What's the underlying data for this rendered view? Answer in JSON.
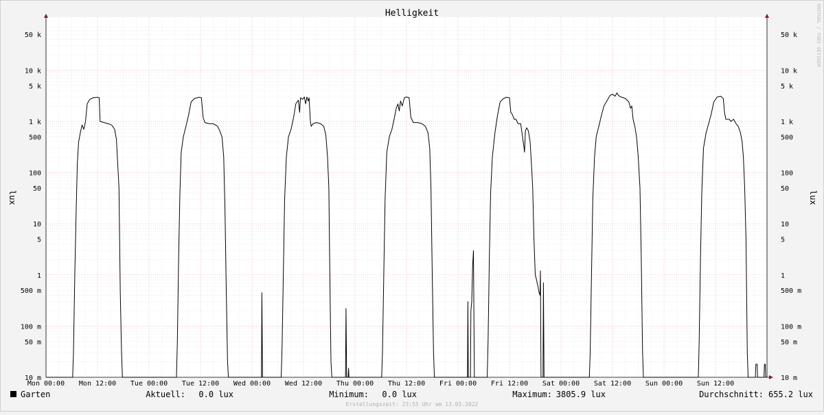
{
  "chart_data": {
    "type": "line",
    "title": "Helligkeit",
    "ylabel_left": "lux",
    "ylabel_right": "lux",
    "watermark": "RRDTOOL / TOBI OETIKER",
    "scale": "log",
    "ylim": [
      0.01,
      80000
    ],
    "xlim": [
      0,
      168
    ],
    "grid": true,
    "y_ticks": [
      {
        "v": 0.01,
        "label": "10 m"
      },
      {
        "v": 0.05,
        "label": "50 m"
      },
      {
        "v": 0.1,
        "label": "100 m"
      },
      {
        "v": 0.5,
        "label": "500 m"
      },
      {
        "v": 1,
        "label": "1"
      },
      {
        "v": 5,
        "label": "5"
      },
      {
        "v": 10,
        "label": "10"
      },
      {
        "v": 50,
        "label": "50"
      },
      {
        "v": 100,
        "label": "100"
      },
      {
        "v": 500,
        "label": "500"
      },
      {
        "v": 1000,
        "label": "1 k"
      },
      {
        "v": 5000,
        "label": "5 k"
      },
      {
        "v": 10000,
        "label": "10 k"
      },
      {
        "v": 50000,
        "label": "50 k"
      }
    ],
    "x_ticks": [
      {
        "h": 0,
        "label": "Mon 00:00"
      },
      {
        "h": 12,
        "label": "Mon 12:00"
      },
      {
        "h": 24,
        "label": "Tue 00:00"
      },
      {
        "h": 36,
        "label": "Tue 12:00"
      },
      {
        "h": 48,
        "label": "Wed 00:00"
      },
      {
        "h": 60,
        "label": "Wed 12:00"
      },
      {
        "h": 72,
        "label": "Thu 00:00"
      },
      {
        "h": 84,
        "label": "Thu 12:00"
      },
      {
        "h": 96,
        "label": "Fri 00:00"
      },
      {
        "h": 108,
        "label": "Fri 12:00"
      },
      {
        "h": 120,
        "label": "Sat 00:00"
      },
      {
        "h": 132,
        "label": "Sat 12:00"
      },
      {
        "h": 144,
        "label": "Sun 00:00"
      },
      {
        "h": 156,
        "label": "Sun 12:00"
      }
    ],
    "series": [
      {
        "name": "Garten",
        "color": "#000000",
        "points": [
          [
            0,
            0.01
          ],
          [
            6.2,
            0.01
          ],
          [
            6.4,
            0.03
          ],
          [
            6.7,
            1
          ],
          [
            7.0,
            15
          ],
          [
            7.3,
            150
          ],
          [
            7.6,
            400
          ],
          [
            8.0,
            600
          ],
          [
            8.4,
            850
          ],
          [
            8.8,
            700
          ],
          [
            9.2,
            1000
          ],
          [
            9.6,
            2200
          ],
          [
            10.2,
            2700
          ],
          [
            11,
            2900
          ],
          [
            12,
            2950
          ],
          [
            12.4,
            2900
          ],
          [
            12.6,
            1000
          ],
          [
            13.5,
            950
          ],
          [
            14.5,
            900
          ],
          [
            15.3,
            850
          ],
          [
            16,
            700
          ],
          [
            16.4,
            450
          ],
          [
            16.7,
            150
          ],
          [
            17,
            50
          ],
          [
            17.3,
            0.5
          ],
          [
            17.6,
            0.03
          ],
          [
            17.8,
            0.01
          ],
          [
            30.4,
            0.01
          ],
          [
            30.6,
            0.05
          ],
          [
            30.9,
            2
          ],
          [
            31.2,
            40
          ],
          [
            31.5,
            250
          ],
          [
            32,
            500
          ],
          [
            32.6,
            800
          ],
          [
            33.2,
            1300
          ],
          [
            33.8,
            2400
          ],
          [
            34.6,
            2800
          ],
          [
            35.6,
            2950
          ],
          [
            36.2,
            2900
          ],
          [
            36.6,
            1200
          ],
          [
            37,
            950
          ],
          [
            38,
            900
          ],
          [
            39,
            900
          ],
          [
            40,
            800
          ],
          [
            40.5,
            650
          ],
          [
            41,
            500
          ],
          [
            41.4,
            200
          ],
          [
            41.7,
            20
          ],
          [
            42,
            0.5
          ],
          [
            42.3,
            0.02
          ],
          [
            42.5,
            0.01
          ],
          [
            50.2,
            0.01
          ],
          [
            50.3,
            0.45
          ],
          [
            50.45,
            0.01
          ],
          [
            54.8,
            0.01
          ],
          [
            55.0,
            0.04
          ],
          [
            55.3,
            1
          ],
          [
            55.6,
            30
          ],
          [
            56,
            200
          ],
          [
            56.5,
            500
          ],
          [
            57.1,
            700
          ],
          [
            57.7,
            1200
          ],
          [
            58.2,
            2200
          ],
          [
            58.8,
            2600
          ],
          [
            59.1,
            1500
          ],
          [
            59.3,
            2900
          ],
          [
            59.8,
            2700
          ],
          [
            60.2,
            3000
          ],
          [
            60.5,
            2200
          ],
          [
            60.8,
            3000
          ],
          [
            61.1,
            2500
          ],
          [
            61.3,
            2900
          ],
          [
            61.6,
            1000
          ],
          [
            61.8,
            800
          ],
          [
            62.2,
            900
          ],
          [
            63,
            950
          ],
          [
            64,
            900
          ],
          [
            64.7,
            800
          ],
          [
            65.2,
            550
          ],
          [
            65.6,
            200
          ],
          [
            65.9,
            50
          ],
          [
            66.1,
            2
          ],
          [
            66.4,
            0.02
          ],
          [
            66.6,
            0.01
          ],
          [
            69.8,
            0.01
          ],
          [
            69.9,
            0.22
          ],
          [
            70.05,
            0.01
          ],
          [
            70.4,
            0.01
          ],
          [
            70.5,
            0.015
          ],
          [
            70.6,
            0.01
          ],
          [
            78.2,
            0.01
          ],
          [
            78.4,
            0.03
          ],
          [
            78.7,
            1
          ],
          [
            79,
            30
          ],
          [
            79.4,
            250
          ],
          [
            80,
            500
          ],
          [
            80.6,
            700
          ],
          [
            81.2,
            1200
          ],
          [
            81.6,
            1800
          ],
          [
            82,
            2200
          ],
          [
            82.3,
            1600
          ],
          [
            82.6,
            2500
          ],
          [
            83,
            2000
          ],
          [
            83.5,
            2900
          ],
          [
            84,
            3000
          ],
          [
            84.6,
            2900
          ],
          [
            85,
            1200
          ],
          [
            85.6,
            950
          ],
          [
            86.6,
            950
          ],
          [
            87.6,
            900
          ],
          [
            88.4,
            800
          ],
          [
            89,
            600
          ],
          [
            89.4,
            300
          ],
          [
            89.7,
            50
          ],
          [
            90,
            1
          ],
          [
            90.3,
            0.03
          ],
          [
            90.5,
            0.01
          ],
          [
            98.2,
            0.01
          ],
          [
            98.3,
            0.3
          ],
          [
            98.4,
            0.01
          ],
          [
            98.9,
            0.01
          ],
          [
            99.0,
            0.2
          ],
          [
            99.2,
            0.3
          ],
          [
            99.4,
            1.5
          ],
          [
            99.6,
            3
          ],
          [
            99.8,
            0.01
          ],
          [
            102.8,
            0.01
          ],
          [
            103.0,
            0.05
          ],
          [
            103.3,
            2
          ],
          [
            103.6,
            40
          ],
          [
            104,
            200
          ],
          [
            104.6,
            600
          ],
          [
            105.2,
            1300
          ],
          [
            105.8,
            2400
          ],
          [
            106.6,
            2800
          ],
          [
            107.3,
            2950
          ],
          [
            108,
            2900
          ],
          [
            108.3,
            1500
          ],
          [
            108.6,
            1400
          ],
          [
            109.1,
            1100
          ],
          [
            109.5,
            1100
          ],
          [
            110,
            900
          ],
          [
            110.6,
            900
          ],
          [
            111.3,
            350
          ],
          [
            111.5,
            250
          ],
          [
            111.7,
            650
          ],
          [
            112,
            750
          ],
          [
            112.4,
            650
          ],
          [
            112.8,
            400
          ],
          [
            113.1,
            150
          ],
          [
            113.4,
            50
          ],
          [
            113.7,
            5
          ],
          [
            114,
            1
          ],
          [
            114.3,
            0.8
          ],
          [
            114.6,
            0.6
          ],
          [
            114.9,
            0.45
          ],
          [
            115.1,
            0.4
          ],
          [
            115.2,
            1.2
          ],
          [
            115.35,
            0.01
          ],
          [
            115.8,
            0.01
          ],
          [
            115.9,
            0.7
          ],
          [
            116.05,
            0.01
          ],
          [
            126.6,
            0.01
          ],
          [
            126.8,
            0.03
          ],
          [
            127.1,
            1
          ],
          [
            127.4,
            30
          ],
          [
            127.8,
            200
          ],
          [
            128.2,
            500
          ],
          [
            128.8,
            800
          ],
          [
            129.4,
            1300
          ],
          [
            130,
            2000
          ],
          [
            130.8,
            2600
          ],
          [
            131.4,
            3200
          ],
          [
            132,
            3400
          ],
          [
            132.6,
            3100
          ],
          [
            133,
            3600
          ],
          [
            133.4,
            3200
          ],
          [
            134,
            3000
          ],
          [
            135,
            2800
          ],
          [
            135.8,
            2400
          ],
          [
            136.2,
            1800
          ],
          [
            136.5,
            2000
          ],
          [
            136.8,
            1100
          ],
          [
            137.2,
            800
          ],
          [
            137.6,
            500
          ],
          [
            138,
            200
          ],
          [
            138.4,
            50
          ],
          [
            138.7,
            2
          ],
          [
            139,
            0.03
          ],
          [
            139.2,
            0.01
          ],
          [
            152,
            0.01
          ],
          [
            152.2,
            0.05
          ],
          [
            152.5,
            2
          ],
          [
            152.8,
            40
          ],
          [
            153.2,
            300
          ],
          [
            153.8,
            600
          ],
          [
            154.4,
            900
          ],
          [
            155,
            1400
          ],
          [
            155.6,
            2400
          ],
          [
            156.4,
            3000
          ],
          [
            157.2,
            3100
          ],
          [
            157.8,
            2800
          ],
          [
            158.1,
            1500
          ],
          [
            158.4,
            1100
          ],
          [
            159.2,
            1100
          ],
          [
            159.6,
            1000
          ],
          [
            160.2,
            1100
          ],
          [
            160.8,
            900
          ],
          [
            161.3,
            800
          ],
          [
            161.8,
            600
          ],
          [
            162.2,
            400
          ],
          [
            162.5,
            200
          ],
          [
            162.8,
            50
          ],
          [
            163.1,
            5
          ],
          [
            163.4,
            0.03
          ],
          [
            163.6,
            0.01
          ],
          [
            165.3,
            0.01
          ],
          [
            165.4,
            0.018
          ],
          [
            165.7,
            0.018
          ],
          [
            165.8,
            0.01
          ],
          [
            167.3,
            0.01
          ],
          [
            167.4,
            0.018
          ],
          [
            167.6,
            0.018
          ],
          [
            167.7,
            0.01
          ],
          [
            168,
            0.01
          ]
        ]
      }
    ]
  },
  "legend": {
    "series_name": "Garten",
    "series_color": "#000000",
    "current_label": "Aktuell:",
    "current_value": "0.0 lux",
    "min_label": "Minimum:",
    "min_value": "0.0 lux",
    "max_label": "Maximum:",
    "max_value": "3805.9 lux",
    "avg_label": "Durchschnitt:",
    "avg_value": "655.2 lux"
  },
  "footer": {
    "created": "Erstellungszeit: 23:55 Uhr am 13.03.2022"
  }
}
